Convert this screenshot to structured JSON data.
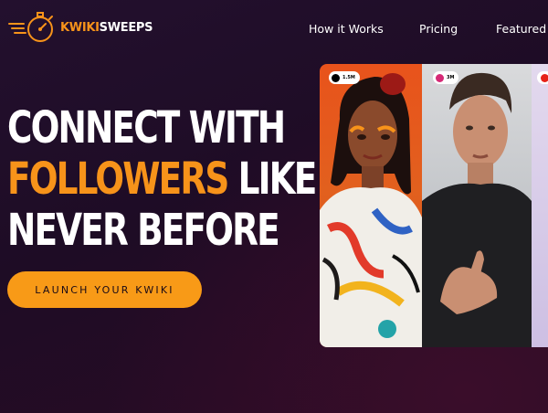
{
  "brand": {
    "name_part1": "KWIKI",
    "name_part2": "SWEEPS",
    "accent": "#f7931a"
  },
  "nav": {
    "items": [
      {
        "label": "How it Works"
      },
      {
        "label": "Pricing"
      },
      {
        "label": "Featured"
      }
    ]
  },
  "hero": {
    "line1": "CONNECT WITH",
    "line2_accent": "FOLLOWERS",
    "line2_rest": " LIKE",
    "line3": "NEVER BEFORE"
  },
  "cta": {
    "label": "LAUNCH YOUR KWIKI"
  },
  "cards": [
    {
      "platform_icon": "tiktok-icon",
      "count": "1.5M"
    },
    {
      "platform_icon": "instagram-icon",
      "count": "3M"
    },
    {
      "platform_icon": "youtube-icon",
      "count": ""
    }
  ]
}
